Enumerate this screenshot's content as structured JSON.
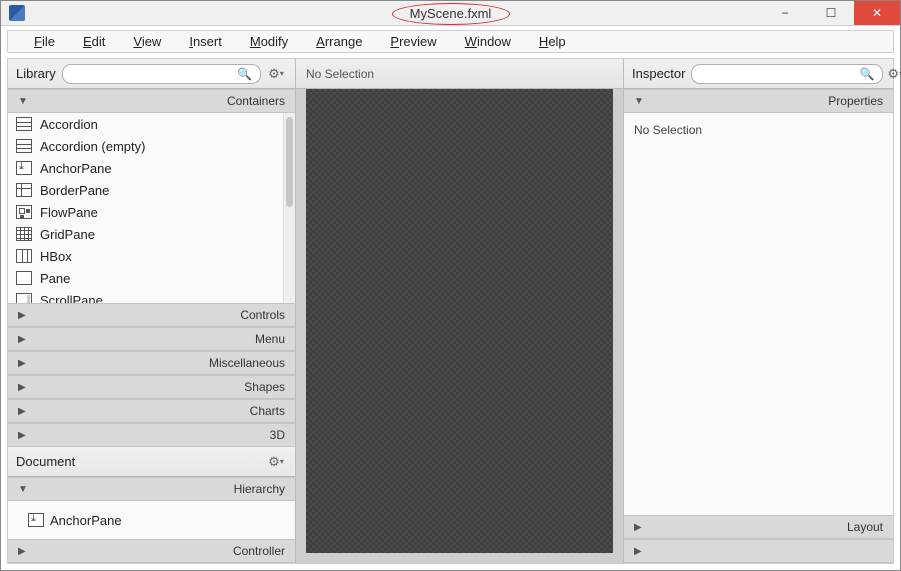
{
  "window": {
    "title": "MyScene.fxml"
  },
  "menubar": {
    "items": [
      "File",
      "Edit",
      "View",
      "Insert",
      "Modify",
      "Arrange",
      "Preview",
      "Window",
      "Help"
    ]
  },
  "library": {
    "title": "Library",
    "search_placeholder": "",
    "sections": {
      "containers": "Containers",
      "controls": "Controls",
      "menu": "Menu",
      "miscellaneous": "Miscellaneous",
      "shapes": "Shapes",
      "charts": "Charts",
      "threeD": "3D"
    },
    "containers_items": [
      {
        "name": "Accordion",
        "icon": "accordion"
      },
      {
        "name": "Accordion  (empty)",
        "icon": "accordion"
      },
      {
        "name": "AnchorPane",
        "icon": "anchor"
      },
      {
        "name": "BorderPane",
        "icon": "border"
      },
      {
        "name": "FlowPane",
        "icon": "flow"
      },
      {
        "name": "GridPane",
        "icon": "grid"
      },
      {
        "name": "HBox",
        "icon": "hbox"
      },
      {
        "name": "Pane",
        "icon": "pane"
      },
      {
        "name": "ScrollPane",
        "icon": "scroll"
      }
    ]
  },
  "document": {
    "title": "Document",
    "sections": {
      "hierarchy": "Hierarchy",
      "controller": "Controller"
    },
    "root_node": "AnchorPane"
  },
  "center": {
    "no_selection": "No Selection"
  },
  "inspector": {
    "title": "Inspector",
    "sections": {
      "properties": "Properties",
      "layout": "Layout"
    },
    "no_selection": "No Selection"
  }
}
